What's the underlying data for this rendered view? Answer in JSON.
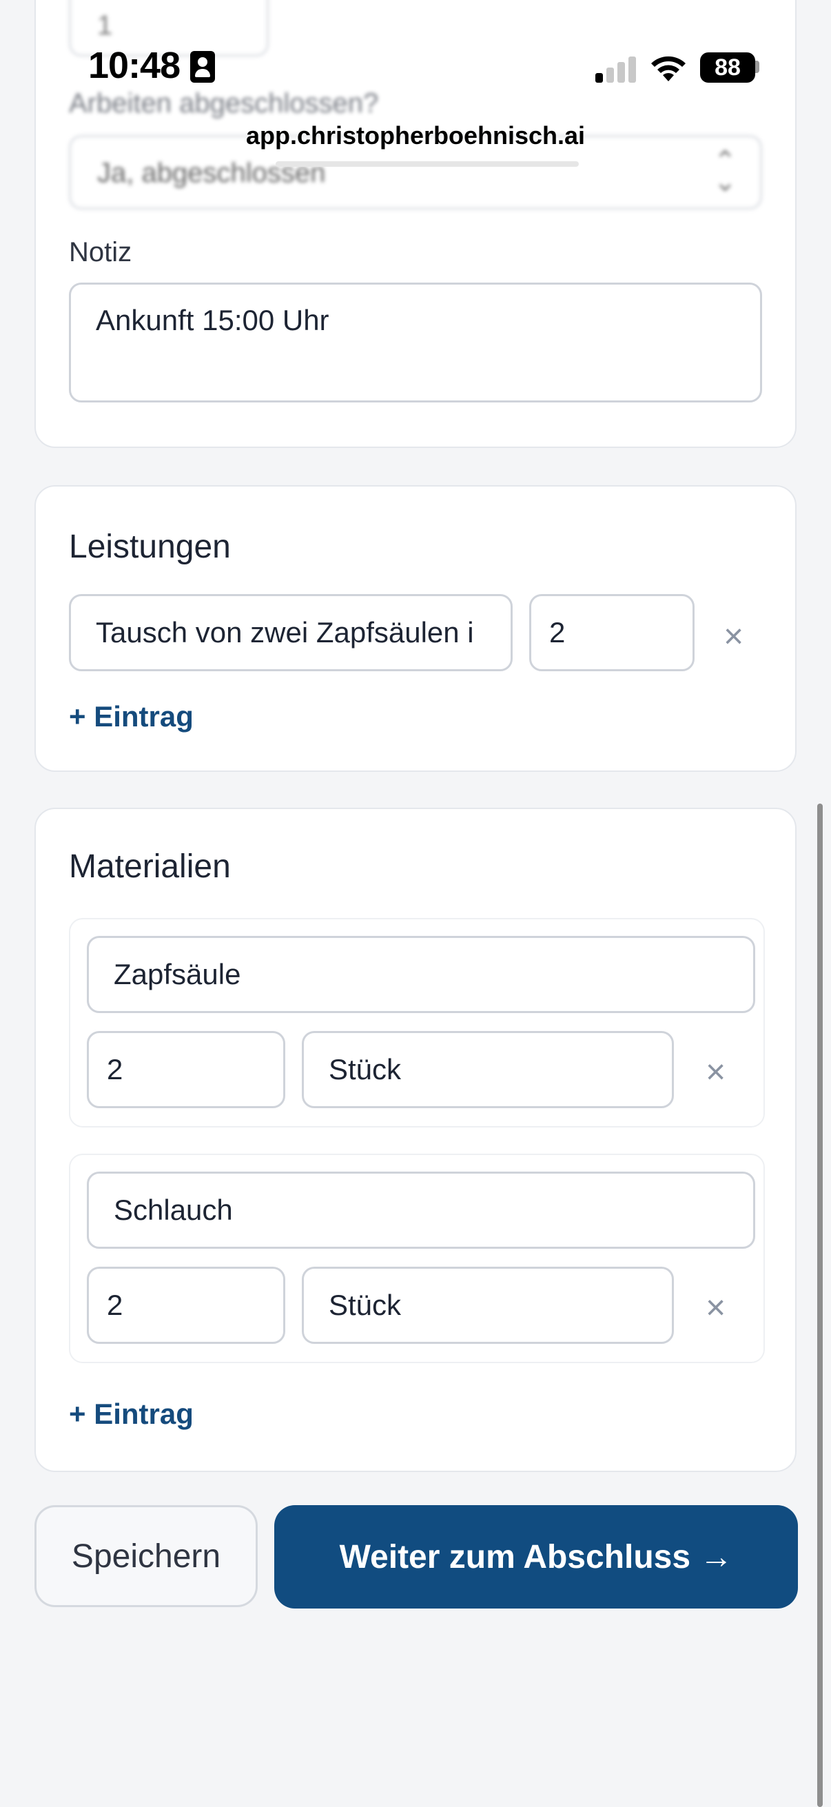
{
  "status_bar": {
    "time": "10:48",
    "battery": "88",
    "url": "app.christopherboehnisch.ai"
  },
  "top_section": {
    "quantity_value": "1",
    "completed_label": "Arbeiten abgeschlossen?",
    "completed_value": "Ja, abgeschlossen",
    "note_label": "Notiz",
    "note_value": "Ankunft 15:00 Uhr"
  },
  "leistungen": {
    "title": "Leistungen",
    "items": [
      {
        "description": "Tausch von zwei Zapfsäulen i",
        "quantity": "2"
      }
    ],
    "add_label": "+ Eintrag"
  },
  "materialien": {
    "title": "Materialien",
    "items": [
      {
        "name": "Zapfsäule",
        "quantity": "2",
        "unit": "Stück"
      },
      {
        "name": "Schlauch",
        "quantity": "2",
        "unit": "Stück"
      }
    ],
    "add_label": "+ Eintrag"
  },
  "actions": {
    "save_label": "Speichern",
    "next_label": "Weiter zum Abschluss →"
  },
  "icons": {
    "remove": "close-icon",
    "select": "chevron-updown-icon"
  },
  "colors": {
    "primary": "#114c80",
    "link": "#154b7d",
    "background": "#f4f5f7"
  }
}
